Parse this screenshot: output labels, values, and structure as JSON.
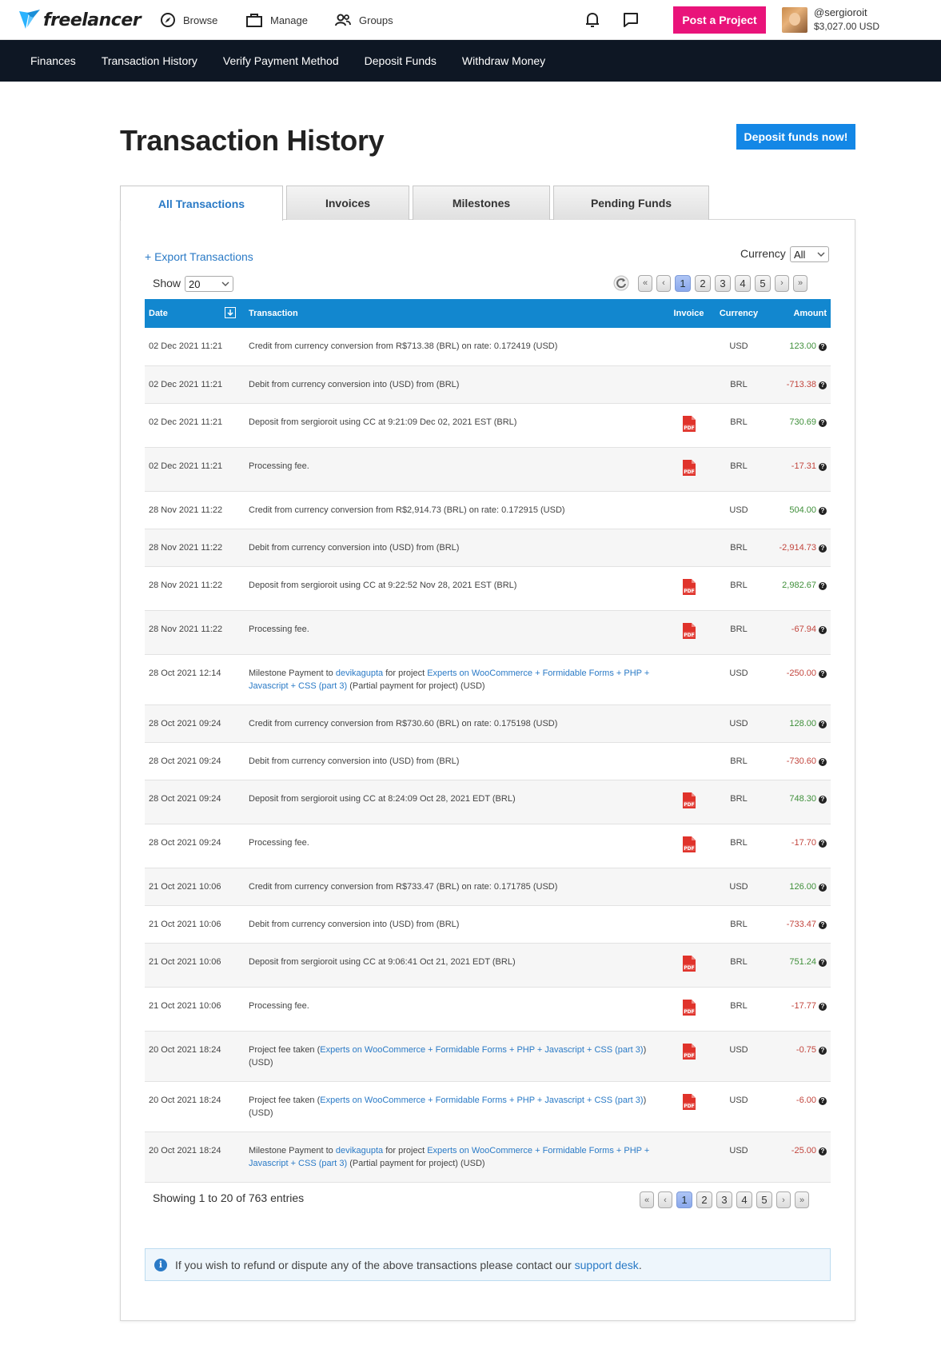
{
  "brand": {
    "name": "freelancer"
  },
  "topnav": {
    "browse": "Browse",
    "manage": "Manage",
    "groups": "Groups",
    "post_project": "Post a Project",
    "username": "@sergioroit",
    "balance": "$3,027.00 USD"
  },
  "subnav": [
    "Finances",
    "Transaction History",
    "Verify Payment Method",
    "Deposit Funds",
    "Withdraw Money"
  ],
  "page": {
    "title": "Transaction History",
    "deposit_now": "Deposit funds now!"
  },
  "tabs": [
    "All Transactions",
    "Invoices",
    "Milestones",
    "Pending Funds"
  ],
  "controls": {
    "export": "+ Export Transactions",
    "currency_label": "Currency",
    "currency_value": "All",
    "show_label": "Show",
    "show_value": "20"
  },
  "pagination": {
    "first": "«",
    "prev": "‹",
    "next": "›",
    "last": "»",
    "pages": [
      "1",
      "2",
      "3",
      "4",
      "5"
    ],
    "current": "1"
  },
  "table": {
    "headers": {
      "date": "Date",
      "transaction": "Transaction",
      "invoice": "Invoice",
      "currency": "Currency",
      "amount": "Amount"
    },
    "rows": [
      {
        "date": "02 Dec 2021 11:21",
        "text": "Credit from currency conversion from R$713.38 (BRL) on rate: 0.172419 (USD)",
        "pdf": false,
        "currency": "USD",
        "amount": "123.00",
        "sign": "pos"
      },
      {
        "date": "02 Dec 2021 11:21",
        "text": "Debit from currency conversion into (USD) from (BRL)",
        "pdf": false,
        "currency": "BRL",
        "amount": "-713.38",
        "sign": "neg"
      },
      {
        "date": "02 Dec 2021 11:21",
        "text": "Deposit from sergioroit using CC at 9:21:09 Dec 02, 2021 EST (BRL)",
        "pdf": true,
        "currency": "BRL",
        "amount": "730.69",
        "sign": "pos"
      },
      {
        "date": "02 Dec 2021 11:21",
        "text": "Processing fee.",
        "pdf": true,
        "currency": "BRL",
        "amount": "-17.31",
        "sign": "neg"
      },
      {
        "date": "28 Nov 2021 11:22",
        "text": "Credit from currency conversion from R$2,914.73 (BRL) on rate: 0.172915 (USD)",
        "pdf": false,
        "currency": "USD",
        "amount": "504.00",
        "sign": "pos"
      },
      {
        "date": "28 Nov 2021 11:22",
        "text": "Debit from currency conversion into (USD) from (BRL)",
        "pdf": false,
        "currency": "BRL",
        "amount": "-2,914.73",
        "sign": "neg"
      },
      {
        "date": "28 Nov 2021 11:22",
        "text": "Deposit from sergioroit using CC at 9:22:52 Nov 28, 2021 EST (BRL)",
        "pdf": true,
        "currency": "BRL",
        "amount": "2,982.67",
        "sign": "pos"
      },
      {
        "date": "28 Nov 2021 11:22",
        "text": "Processing fee.",
        "pdf": true,
        "currency": "BRL",
        "amount": "-67.94",
        "sign": "neg"
      },
      {
        "date": "28 Oct 2021 12:14",
        "parts": [
          {
            "t": "Milestone Payment to "
          },
          {
            "t": "devikagupta",
            "link": true
          },
          {
            "t": " for project "
          },
          {
            "t": "Experts on WooCommerce + Formidable Forms + PHP + Javascript + CSS (part 3)",
            "link": true
          },
          {
            "t": " (Partial payment for project) (USD)"
          }
        ],
        "pdf": false,
        "currency": "USD",
        "amount": "-250.00",
        "sign": "neg"
      },
      {
        "date": "28 Oct 2021 09:24",
        "text": "Credit from currency conversion from R$730.60 (BRL) on rate: 0.175198 (USD)",
        "pdf": false,
        "currency": "USD",
        "amount": "128.00",
        "sign": "pos"
      },
      {
        "date": "28 Oct 2021 09:24",
        "text": "Debit from currency conversion into (USD) from (BRL)",
        "pdf": false,
        "currency": "BRL",
        "amount": "-730.60",
        "sign": "neg"
      },
      {
        "date": "28 Oct 2021 09:24",
        "text": "Deposit from sergioroit using CC at 8:24:09 Oct 28, 2021 EDT (BRL)",
        "pdf": true,
        "currency": "BRL",
        "amount": "748.30",
        "sign": "pos"
      },
      {
        "date": "28 Oct 2021 09:24",
        "text": "Processing fee.",
        "pdf": true,
        "currency": "BRL",
        "amount": "-17.70",
        "sign": "neg"
      },
      {
        "date": "21 Oct 2021 10:06",
        "text": "Credit from currency conversion from R$733.47 (BRL) on rate: 0.171785 (USD)",
        "pdf": false,
        "currency": "USD",
        "amount": "126.00",
        "sign": "pos"
      },
      {
        "date": "21 Oct 2021 10:06",
        "text": "Debit from currency conversion into (USD) from (BRL)",
        "pdf": false,
        "currency": "BRL",
        "amount": "-733.47",
        "sign": "neg"
      },
      {
        "date": "21 Oct 2021 10:06",
        "text": "Deposit from sergioroit using CC at 9:06:41 Oct 21, 2021 EDT (BRL)",
        "pdf": true,
        "currency": "BRL",
        "amount": "751.24",
        "sign": "pos"
      },
      {
        "date": "21 Oct 2021 10:06",
        "text": "Processing fee.",
        "pdf": true,
        "currency": "BRL",
        "amount": "-17.77",
        "sign": "neg"
      },
      {
        "date": "20 Oct 2021 18:24",
        "parts": [
          {
            "t": "Project fee taken ("
          },
          {
            "t": "Experts on WooCommerce + Formidable Forms + PHP + Javascript + CSS (part 3)",
            "link": true
          },
          {
            "t": ") (USD)"
          }
        ],
        "pdf": true,
        "currency": "USD",
        "amount": "-0.75",
        "sign": "neg"
      },
      {
        "date": "20 Oct 2021 18:24",
        "parts": [
          {
            "t": "Project fee taken ("
          },
          {
            "t": "Experts on WooCommerce + Formidable Forms + PHP + Javascript + CSS (part 3)",
            "link": true
          },
          {
            "t": ") (USD)"
          }
        ],
        "pdf": true,
        "currency": "USD",
        "amount": "-6.00",
        "sign": "neg"
      },
      {
        "date": "20 Oct 2021 18:24",
        "parts": [
          {
            "t": "Milestone Payment to "
          },
          {
            "t": "devikagupta",
            "link": true
          },
          {
            "t": " for project "
          },
          {
            "t": "Experts on WooCommerce + Formidable Forms + PHP + Javascript + CSS (part 3)",
            "link": true
          },
          {
            "t": " (Partial payment for project) (USD)"
          }
        ],
        "pdf": false,
        "currency": "USD",
        "amount": "-25.00",
        "sign": "neg"
      }
    ]
  },
  "footer": {
    "showing": "Showing 1 to 20 of 763 entries",
    "info_text": "If you wish to refund or dispute any of the above transactions please contact our ",
    "info_link": "support desk",
    "info_end": "."
  },
  "icons": {
    "logo": "freelancer-bird-logo",
    "browse": "compass-icon",
    "manage": "briefcase-icon",
    "groups": "users-icon",
    "notifications": "bell-icon",
    "messages": "chat-icon",
    "refresh": "refresh-icon",
    "pdf": "pdf-icon",
    "help": "question-circle-icon",
    "info": "info-icon",
    "sort": "sort-down-icon"
  },
  "colors": {
    "post_button": "#e9137a",
    "subnav_bg": "#0e1724",
    "deposit_button": "#1387e6",
    "table_header": "#1287cf",
    "positive": "#3f8f3a",
    "negative": "#c2453d",
    "link": "#2a7ac6"
  }
}
